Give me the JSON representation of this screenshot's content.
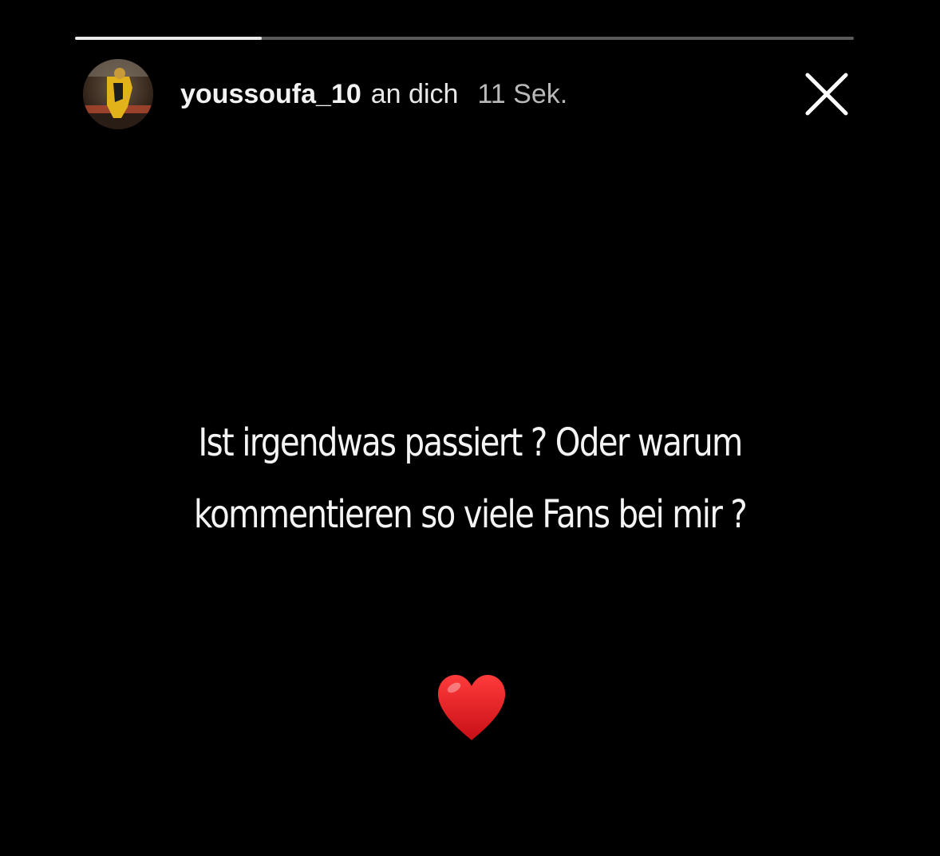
{
  "story": {
    "progress": 0.24,
    "header": {
      "username": "youssoufa_10",
      "recipient": "an dich",
      "timestamp": "11 Sek."
    },
    "message_lines": [
      "Ist irgendwas passiert ? Oder warum",
      "kommentieren so viele Fans bei mir ?"
    ],
    "emoji": "red-heart"
  },
  "colors": {
    "background": "#000000",
    "text": "#f4f4f4",
    "timestamp": "#b9b9b9",
    "heart": "#e0141e"
  },
  "icons": {
    "close": "close-icon",
    "heart": "heart-icon"
  }
}
